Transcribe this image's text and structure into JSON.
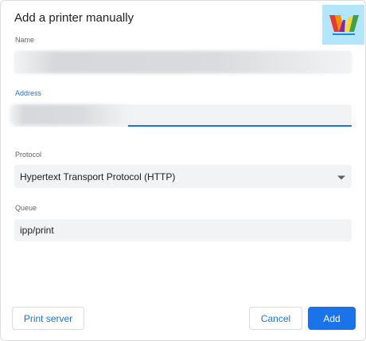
{
  "dialog": {
    "title": "Add a printer manually"
  },
  "fields": {
    "name_label": "Name",
    "name_value": "",
    "address_label": "Address",
    "address_value": "",
    "protocol_label": "Protocol",
    "protocol_value": "Hypertext Transport Protocol (HTTP)",
    "queue_label": "Queue",
    "queue_value": "ipp/print"
  },
  "buttons": {
    "print_server": "Print server",
    "cancel": "Cancel",
    "add": "Add"
  },
  "colors": {
    "accent": "#1a73e8",
    "field_bg": "#f1f3f4",
    "logo_bg": "#b3e5fc"
  },
  "icons": {
    "protocol_dropdown": "arrow-drop-down-icon",
    "watermark": "w-logo-icon"
  }
}
